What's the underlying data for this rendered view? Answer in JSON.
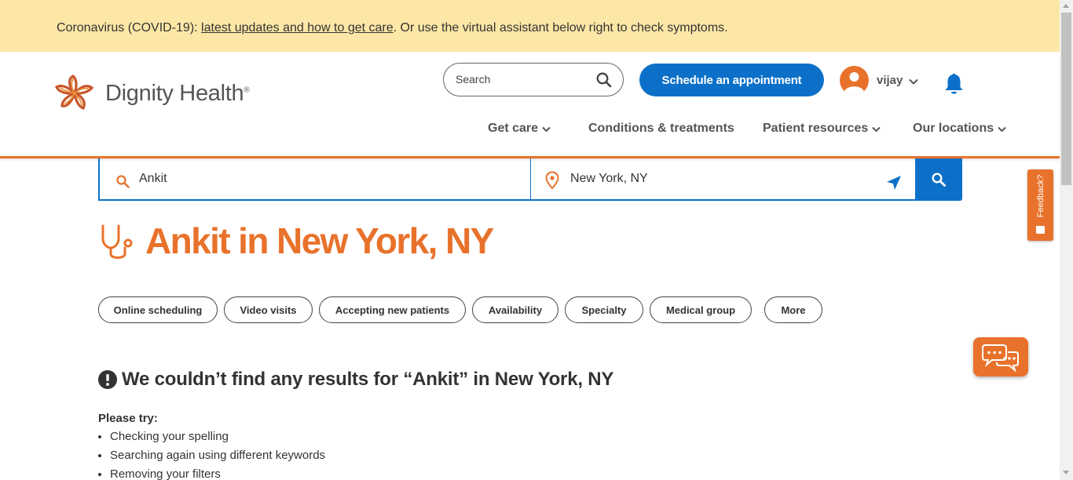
{
  "banner": {
    "prefix": "Coronavirus (COVID-19): ",
    "link": "latest updates and how to get care",
    "suffix": ". Or use the virtual assistant below right to check symptoms."
  },
  "header": {
    "logo_text": "Dignity Health",
    "logo_mark": "®",
    "search_placeholder": "Search",
    "schedule_label": "Schedule an appointment",
    "user_name": "vijay"
  },
  "nav": [
    {
      "label": "Get care",
      "has_dropdown": true
    },
    {
      "label": "Conditions & treatments",
      "has_dropdown": false
    },
    {
      "label": "Patient resources",
      "has_dropdown": true
    },
    {
      "label": "Our locations",
      "has_dropdown": true
    }
  ],
  "finder": {
    "query": "Ankit",
    "location": "New York, NY"
  },
  "page_title": "Ankit in New York, NY",
  "filters": [
    "Online scheduling",
    "Video visits",
    "Accepting new patients",
    "Availability",
    "Specialty",
    "Medical group",
    "More"
  ],
  "no_results": {
    "heading": "We couldn’t find any results for “Ankit” in New York, NY",
    "please_try": "Please try:",
    "tips": [
      "Checking your spelling",
      "Searching again using different keywords",
      "Removing your filters"
    ]
  },
  "feedback_label": "Feedback?",
  "colors": {
    "brand_orange": "#e8722b",
    "brand_blue": "#0c70c8",
    "banner_bg": "#fde7a6"
  },
  "icons": [
    "logo-icon",
    "search-icon",
    "user-icon",
    "chevron-down-icon",
    "bell-icon",
    "location-pin-icon",
    "locate-arrow-icon",
    "stethoscope-icon",
    "alert-icon",
    "chat-icon",
    "feedback-icon"
  ]
}
